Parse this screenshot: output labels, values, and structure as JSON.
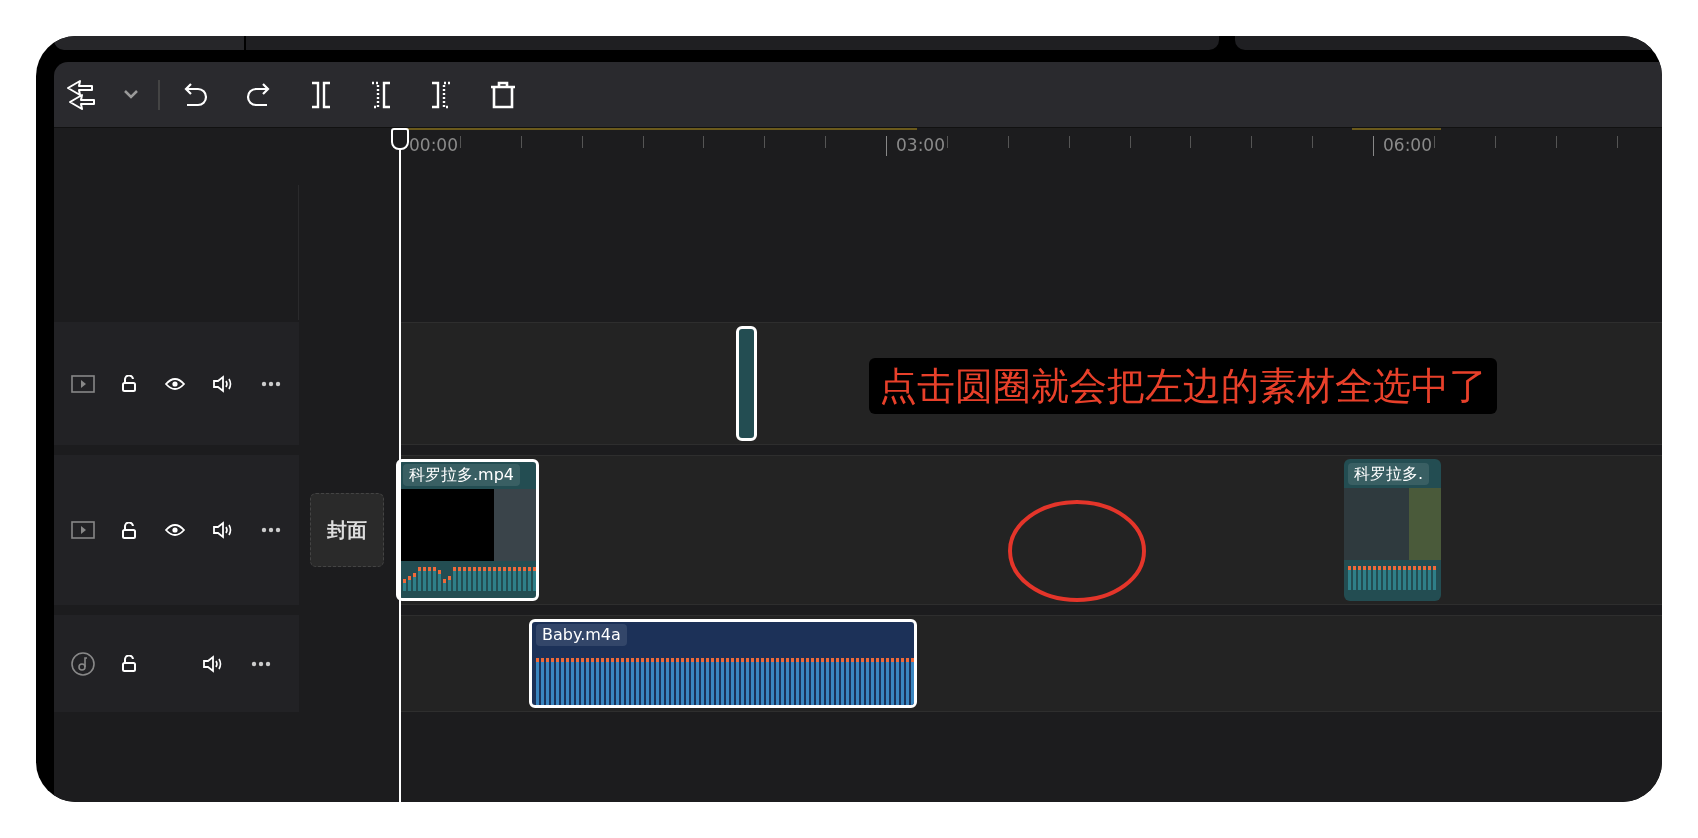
{
  "ruler": {
    "labels": [
      "00:00",
      "03:00",
      "06:00"
    ]
  },
  "tracks": [
    {
      "kind": "overlay",
      "locked": false,
      "visible": true,
      "muted": false,
      "clips": [
        {
          "kind": "blank",
          "selected": true
        }
      ]
    },
    {
      "kind": "main",
      "locked": false,
      "visible": true,
      "muted": false,
      "cover": "封面",
      "clips": [
        {
          "kind": "video",
          "title": "科罗拉多.mp4",
          "selected": true
        },
        {
          "kind": "video",
          "title": "科罗拉多.",
          "selected": false
        }
      ]
    },
    {
      "kind": "audio",
      "locked": false,
      "muted": false,
      "clips": [
        {
          "kind": "audio",
          "title": "Baby.m4a",
          "selected": true
        }
      ]
    }
  ],
  "annotation": {
    "text": "点击圆圈就会把左边的素材全选中了"
  }
}
